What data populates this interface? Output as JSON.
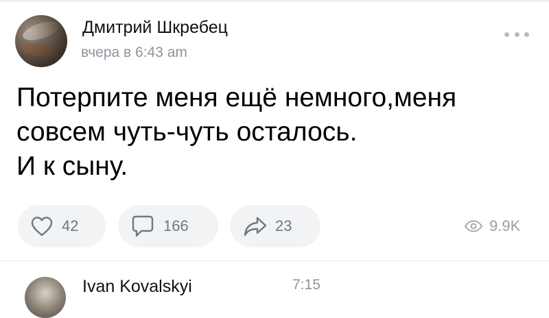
{
  "post": {
    "author": "Дмитрий Шкребец",
    "time": "вчера в 6:43 am",
    "text_lines": [
      "Потерпите меня ещё немного,меня",
      "совсем чуть-чуть осталось.",
      "И к сыну."
    ],
    "likes": "42",
    "comments": "166",
    "shares": "23",
    "views": "9.9K"
  },
  "next_post": {
    "author": "Ivan Kovalskyi",
    "time": "7:15"
  },
  "icons": {
    "like": "heart-icon",
    "comment": "comment-icon",
    "share": "share-icon",
    "views": "eye-icon",
    "more": "more-dots-icon"
  },
  "colors": {
    "action_bg": "#f2f3f5",
    "secondary_text": "#6d7885",
    "muted_text": "#8d949c",
    "divider": "#e7e8ec"
  }
}
